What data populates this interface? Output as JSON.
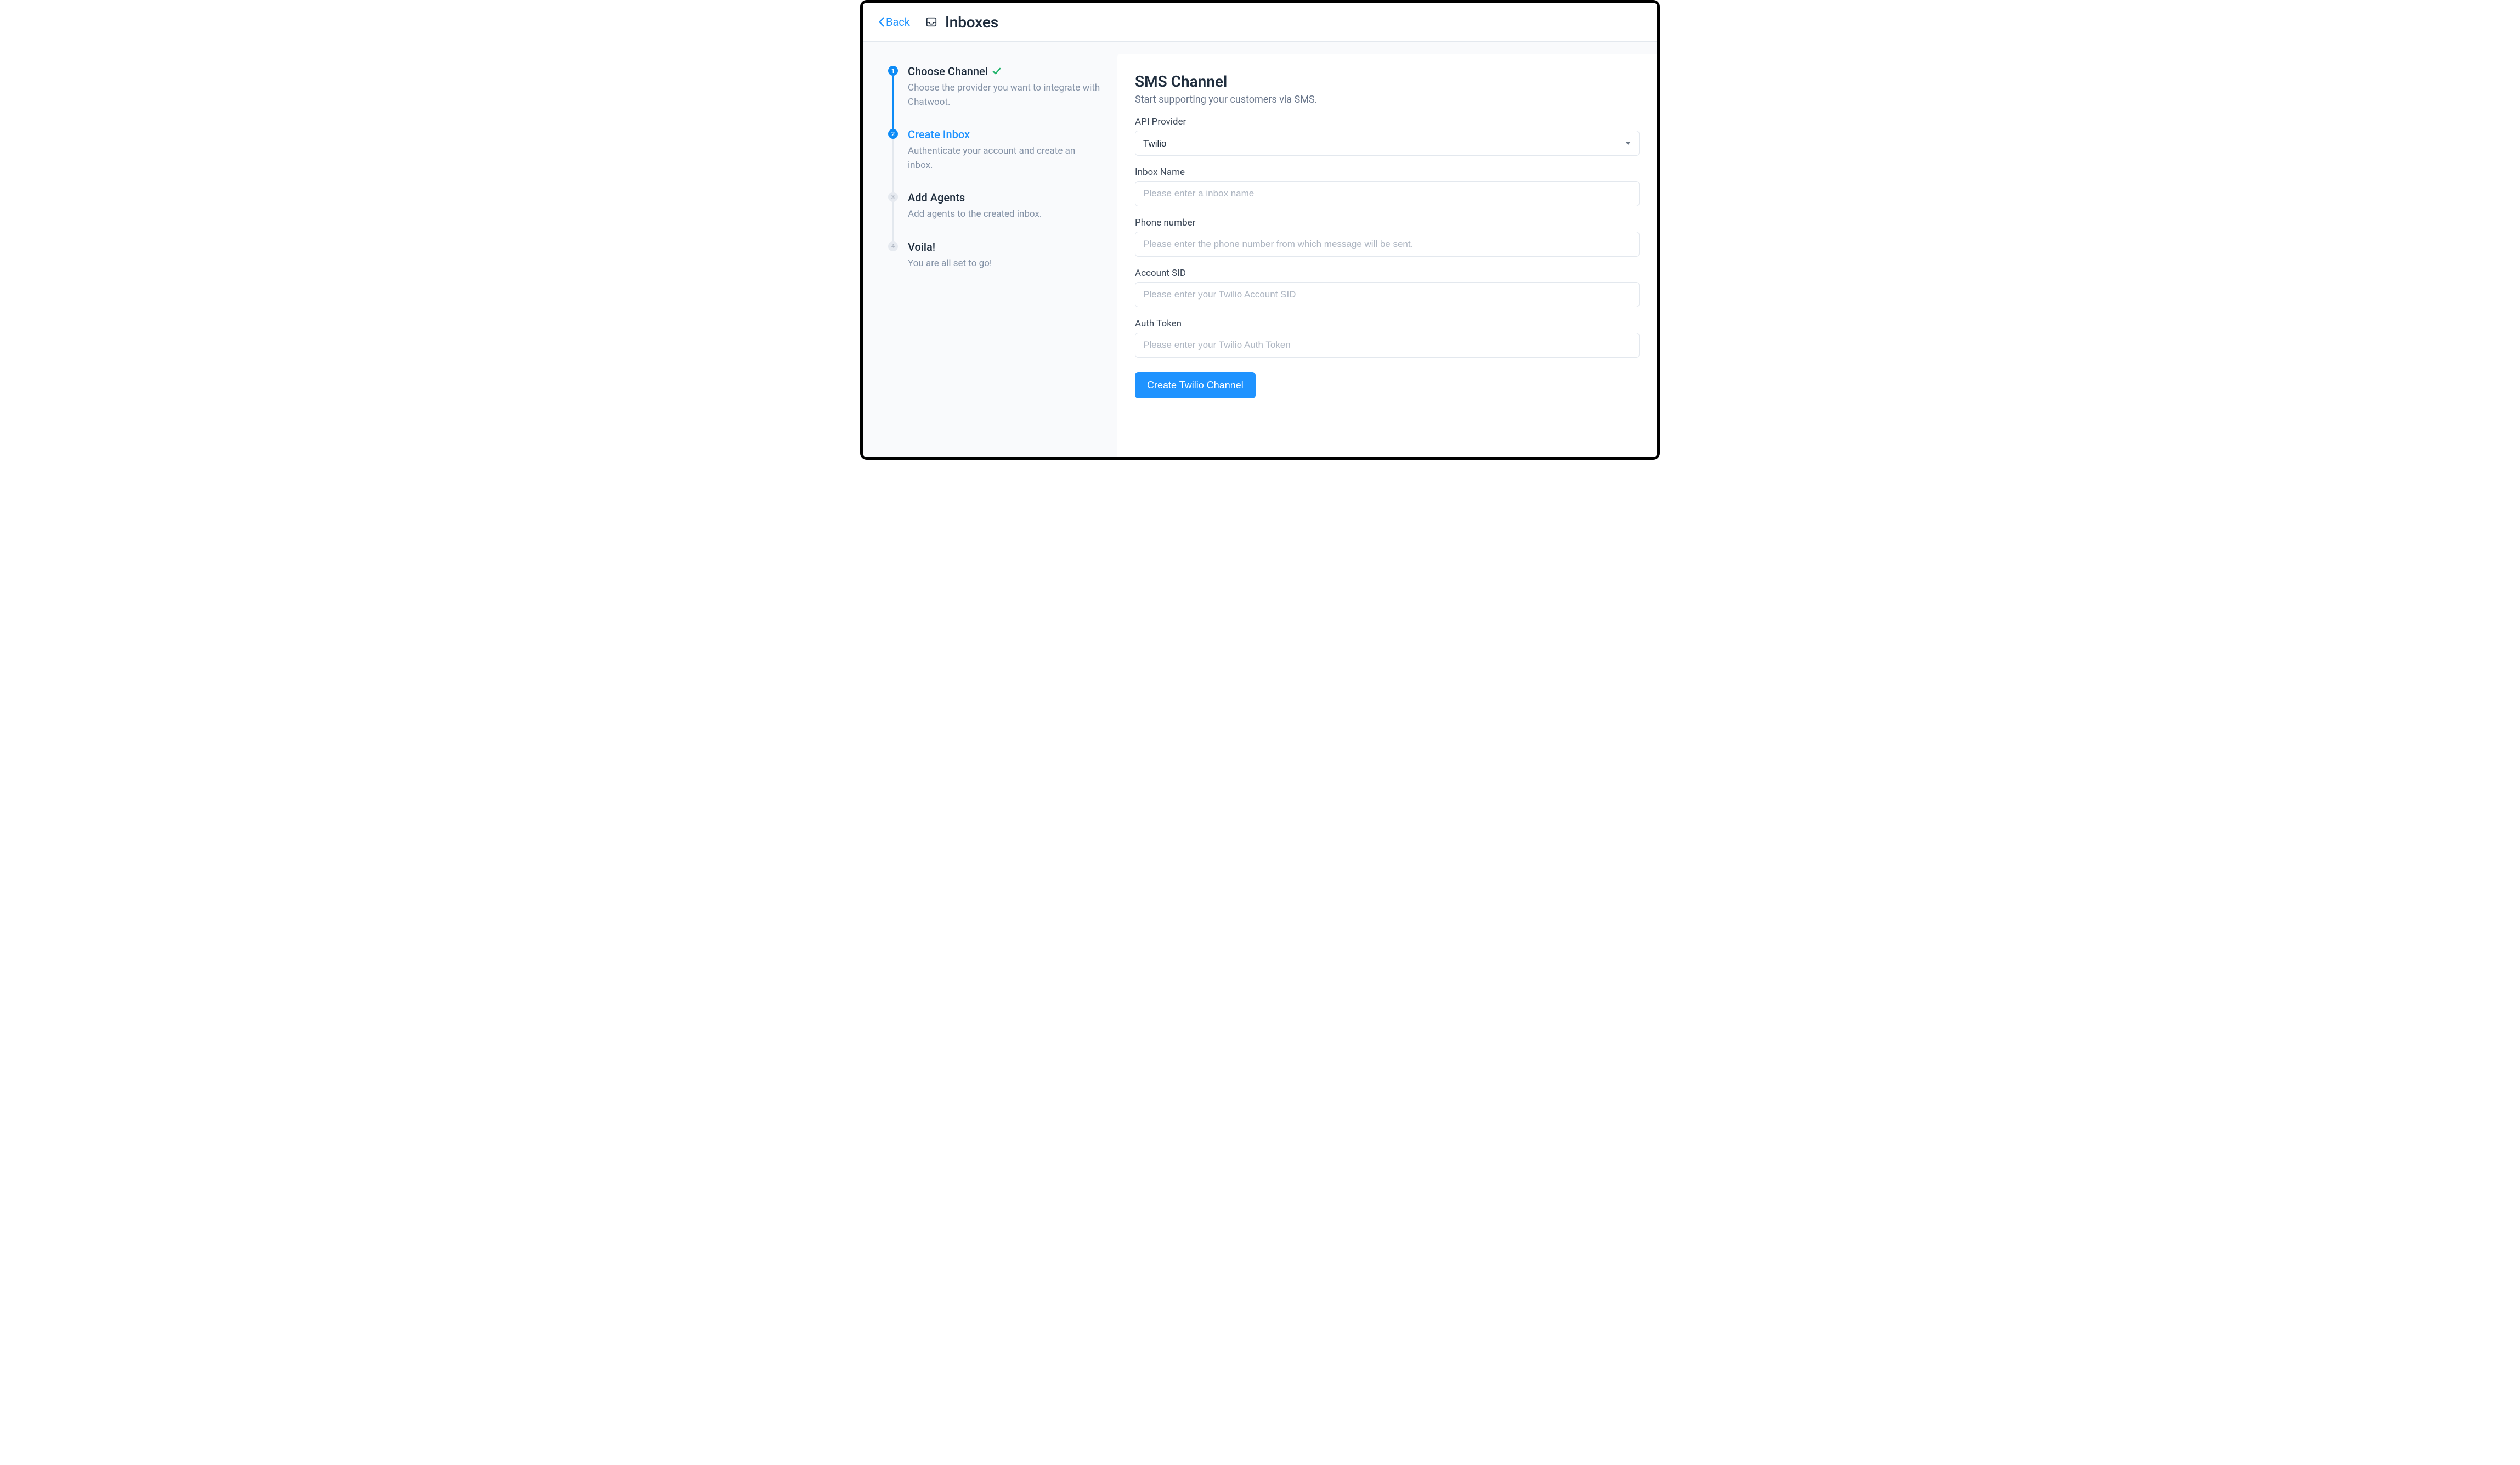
{
  "header": {
    "back_label": "Back",
    "page_title": "Inboxes"
  },
  "stepper": [
    {
      "num": "1",
      "title": "Choose Channel",
      "desc": "Choose the provider you want to integrate with Chatwoot.",
      "state": "done"
    },
    {
      "num": "2",
      "title": "Create Inbox",
      "desc": "Authenticate your account and create an inbox.",
      "state": "active"
    },
    {
      "num": "3",
      "title": "Add Agents",
      "desc": "Add agents to the created inbox.",
      "state": "todo"
    },
    {
      "num": "4",
      "title": "Voila!",
      "desc": "You are all set to go!",
      "state": "todo"
    }
  ],
  "form": {
    "title": "SMS Channel",
    "subtitle": "Start supporting your customers via SMS.",
    "api_provider": {
      "label": "API Provider",
      "selected": "Twilio"
    },
    "inbox_name": {
      "label": "Inbox Name",
      "placeholder": "Please enter a inbox name"
    },
    "phone_number": {
      "label": "Phone number",
      "placeholder": "Please enter the phone number from which message will be sent."
    },
    "account_sid": {
      "label": "Account SID",
      "placeholder": "Please enter your Twilio Account SID"
    },
    "auth_token": {
      "label": "Auth Token",
      "placeholder": "Please enter your Twilio Auth Token"
    },
    "submit_label": "Create Twilio Channel"
  }
}
